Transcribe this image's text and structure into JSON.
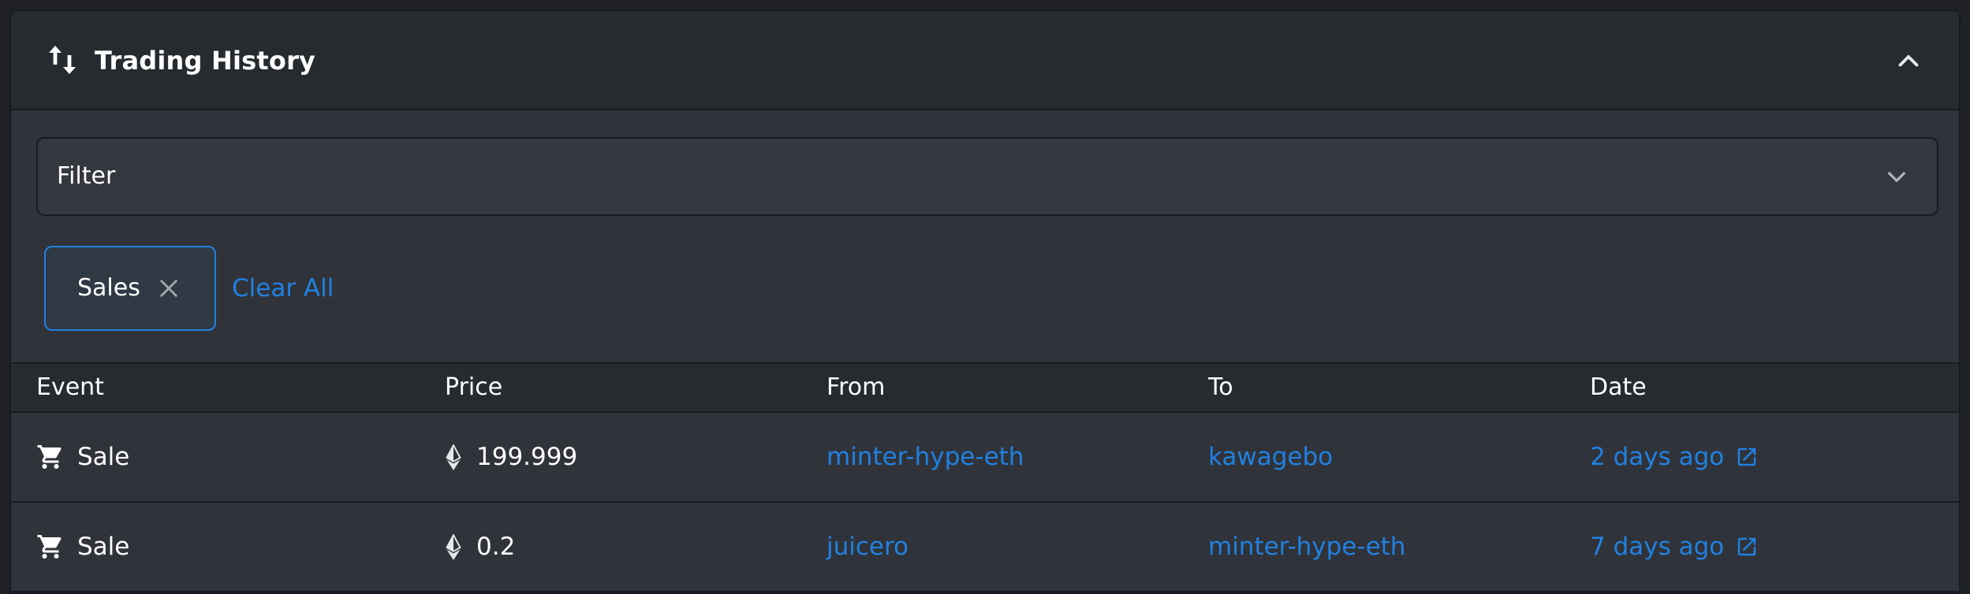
{
  "header": {
    "title": "Trading History",
    "icon": "swap-vertical-icon",
    "collapse_icon": "chevron-up-icon"
  },
  "filter": {
    "label": "Filter",
    "icon": "chevron-down-icon"
  },
  "active_filters": [
    {
      "label": "Sales",
      "remove_icon": "close-icon"
    }
  ],
  "clear_all_label": "Clear All",
  "table": {
    "columns": [
      "Event",
      "Price",
      "From",
      "To",
      "Date"
    ],
    "rows": [
      {
        "event": "Sale",
        "event_icon": "cart-icon",
        "price": "199.999",
        "price_icon": "ethereum-icon",
        "from": "minter-hype-eth",
        "to": "kawagebo",
        "date": "2 days ago",
        "date_icon": "external-link-icon"
      },
      {
        "event": "Sale",
        "event_icon": "cart-icon",
        "price": "0.2",
        "price_icon": "ethereum-icon",
        "from": "juicero",
        "to": "minter-hype-eth",
        "date": "7 days ago",
        "date_icon": "external-link-icon"
      }
    ]
  },
  "colors": {
    "background": "#303339",
    "header_bg": "#262b2f",
    "accent_link": "#2081e2",
    "text": "#ffffff",
    "border": "#151b22"
  }
}
